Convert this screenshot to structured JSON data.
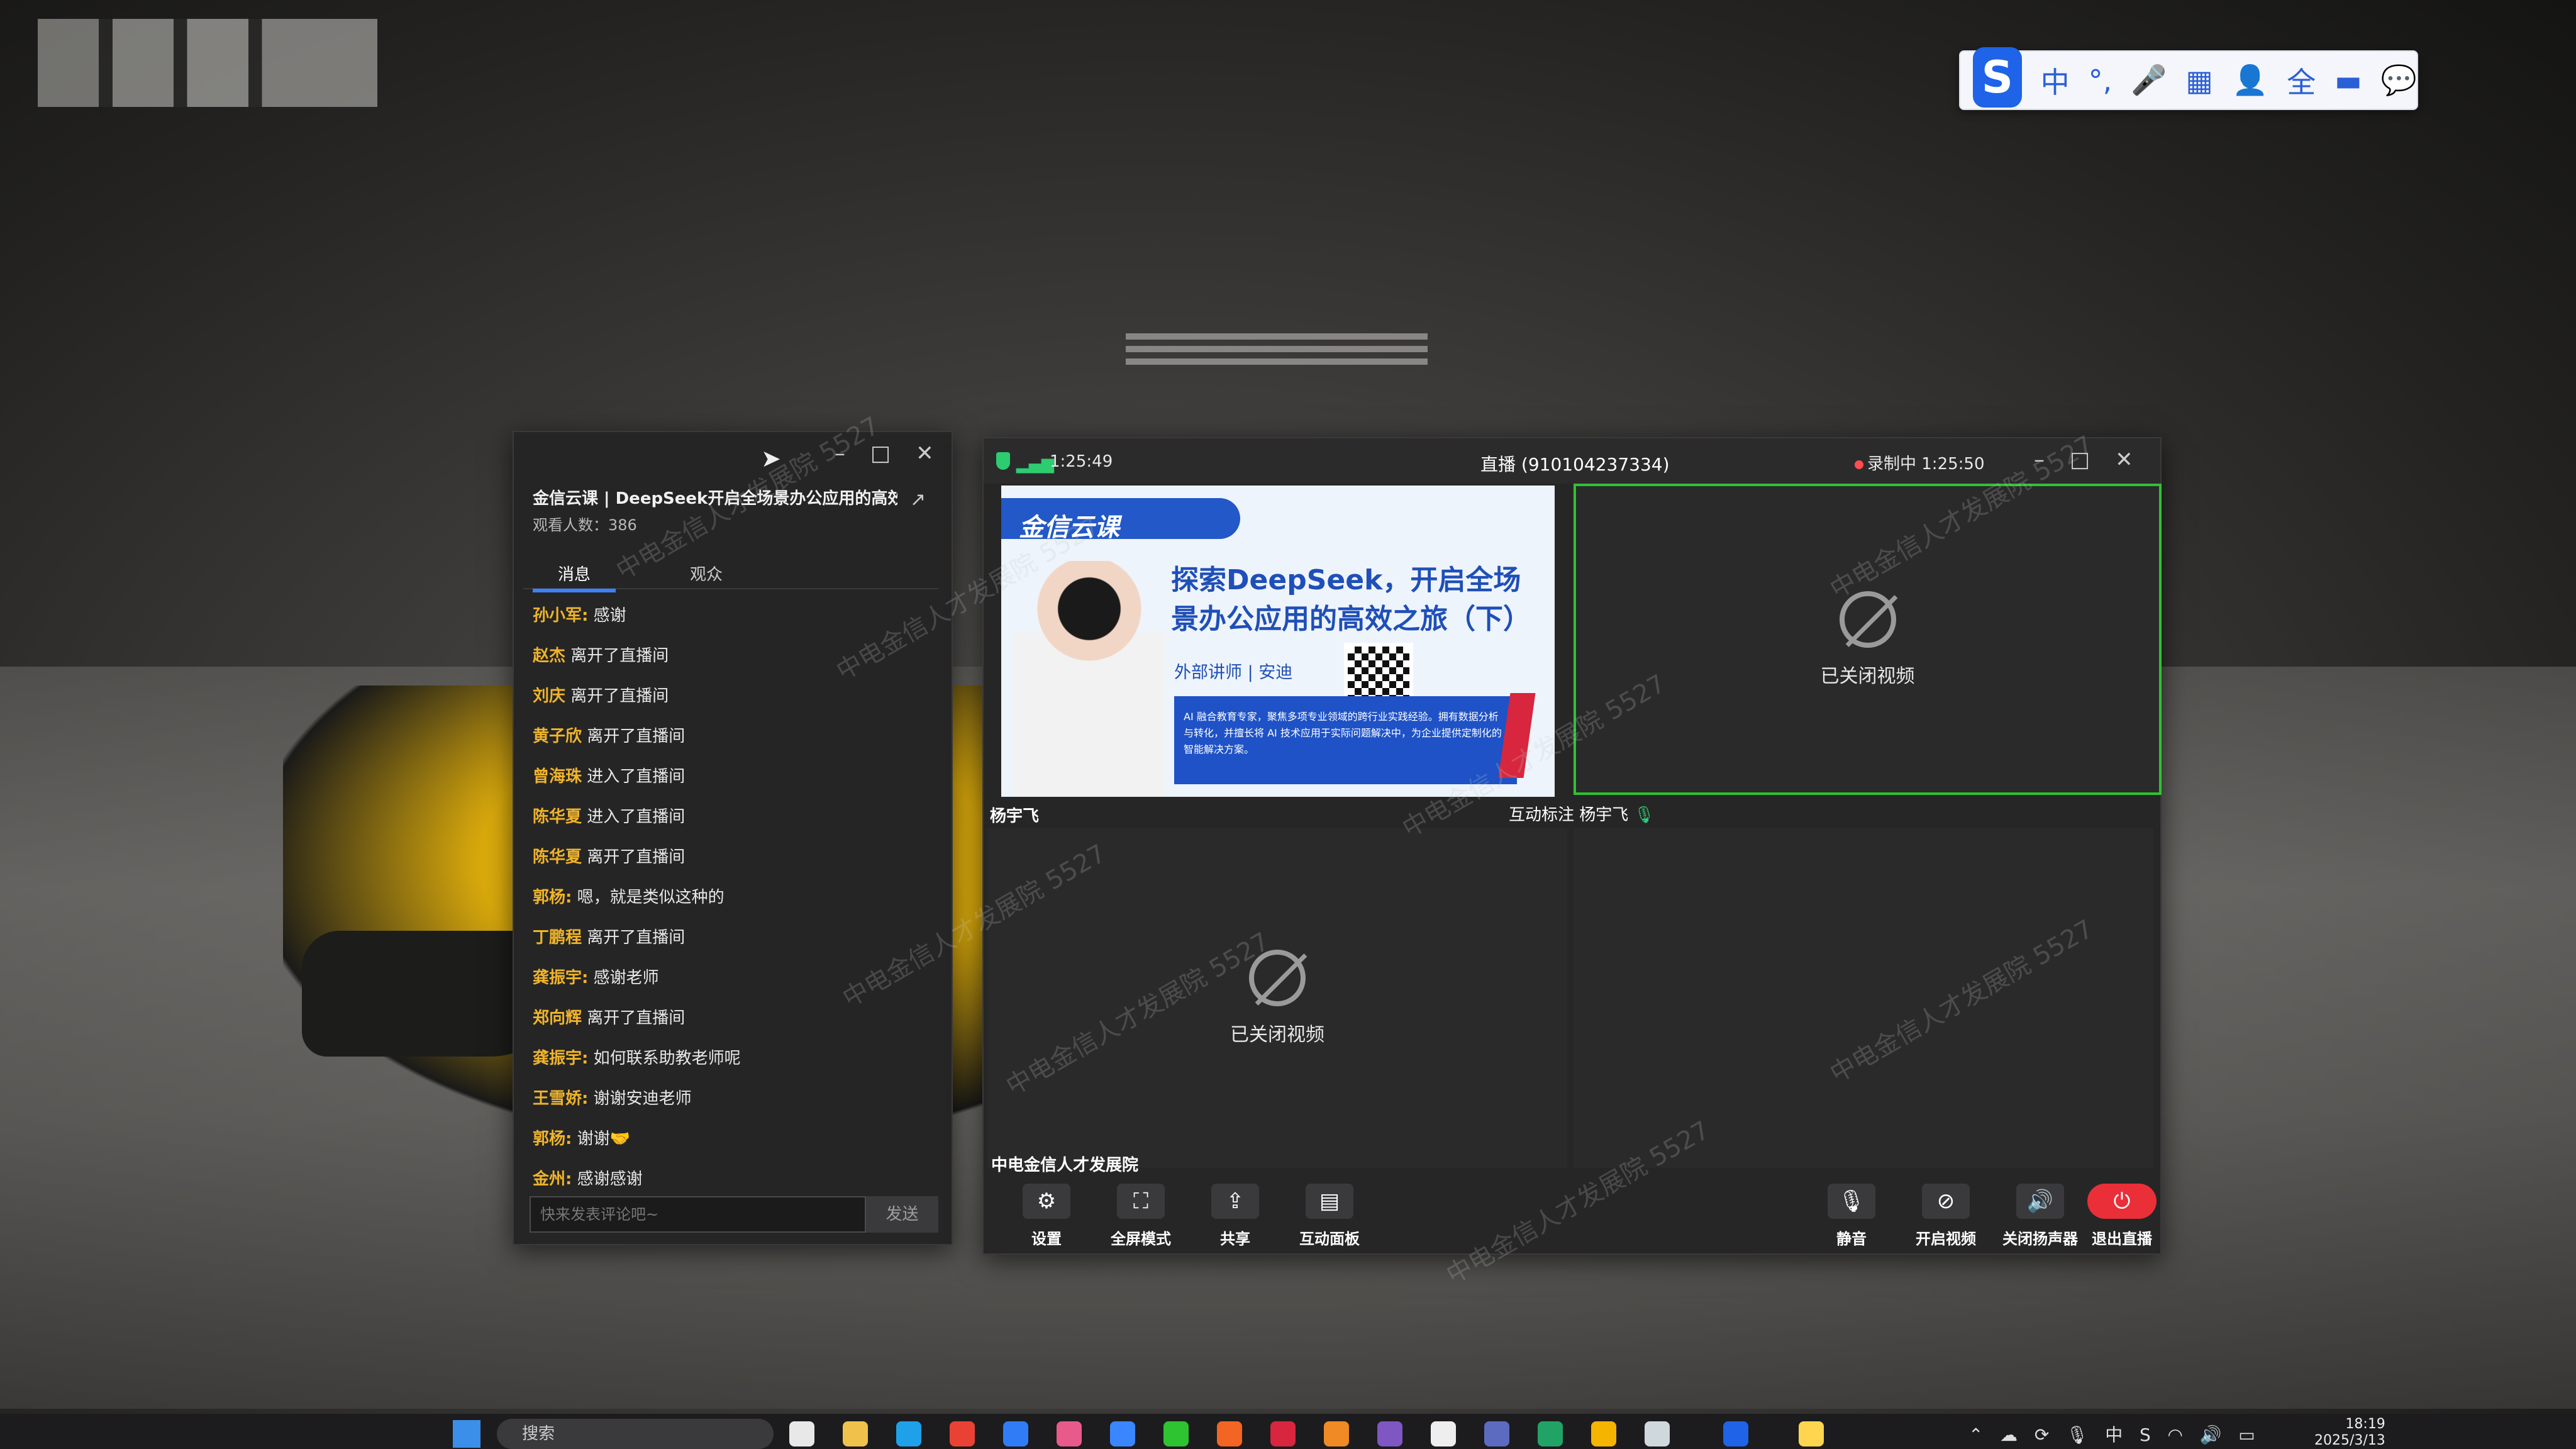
{
  "ime": {
    "lang": "中",
    "punct": "°,",
    "mic": "🎤",
    "keyboard": "▦",
    "user": "👤",
    "fullwidth": "全",
    "folder": "▬",
    "chat": "💬"
  },
  "chat_window": {
    "title": "金信云课 | DeepSeek开启全场景办公应用的高效...",
    "viewers": "观看人数：386",
    "tabs": [
      "消息",
      "观众"
    ],
    "messages": [
      {
        "who": "孙小军:",
        "what": " 感谢"
      },
      {
        "who": "赵杰",
        "what": " 离开了直播间"
      },
      {
        "who": "刘庆",
        "what": " 离开了直播间"
      },
      {
        "who": "黄子欣",
        "what": " 离开了直播间"
      },
      {
        "who": "曾海珠",
        "what": " 进入了直播间"
      },
      {
        "who": "陈华夏",
        "what": " 进入了直播间"
      },
      {
        "who": "陈华夏",
        "what": " 离开了直播间"
      },
      {
        "who": "郭杨:",
        "what": " 嗯，就是类似这种的"
      },
      {
        "who": "丁鹏程",
        "what": " 离开了直播间"
      },
      {
        "who": "龚振宇:",
        "what": " 感谢老师"
      },
      {
        "who": "郑向辉",
        "what": " 离开了直播间"
      },
      {
        "who": "龚振宇:",
        "what": " 如何联系助教老师呢"
      },
      {
        "who": "王雪娇:",
        "what": " 谢谢安迪老师"
      },
      {
        "who": "郭杨:",
        "what": " 谢谢🤝"
      },
      {
        "who": "金州:",
        "what": " 感谢感谢"
      }
    ],
    "input_placeholder": "快来发表评论吧~",
    "send_label": "发送"
  },
  "live_window": {
    "elapsed": "1:25:49",
    "room_title": "直播 (910104237334)",
    "recording": "录制中 1:25:50",
    "slide": {
      "brand": "金信云课",
      "headline": "探索DeepSeek，开启全场景办公应用的高效之旅（下）",
      "speaker": "外部讲师 | 安迪",
      "bio": "AI 融合教育专家，聚焦多项专业领域的跨行业实践经验。拥有数据分析与转化，并擅长将 AI 技术应用于实际问题解决中，为企业提供定制化的智能解决方案。"
    },
    "cam_off_label": "已关闭视频",
    "presenter_name": "杨宇飞",
    "speaker_label": "互动标注",
    "speaker_name": "杨宇飞",
    "host_name": "中电金信人才发展院",
    "tools_left": [
      {
        "icon": "⚙",
        "label": "设置"
      },
      {
        "icon": "⛶",
        "label": "全屏模式"
      },
      {
        "icon": "⇪",
        "label": "共享"
      },
      {
        "icon": "▤",
        "label": "互动面板"
      }
    ],
    "tools_right": [
      {
        "icon": "🎙",
        "label": "静音"
      },
      {
        "icon": "⊘",
        "label": "开启视频"
      },
      {
        "icon": "🔊",
        "label": "关闭扬声器"
      },
      {
        "icon": "⏻",
        "label": "退出直播"
      }
    ]
  },
  "watermark": "中电金信人才发展院 5527",
  "taskbar": {
    "search": "搜索",
    "tray_lang": "中",
    "time": "18:19",
    "date": "2025/3/13"
  }
}
